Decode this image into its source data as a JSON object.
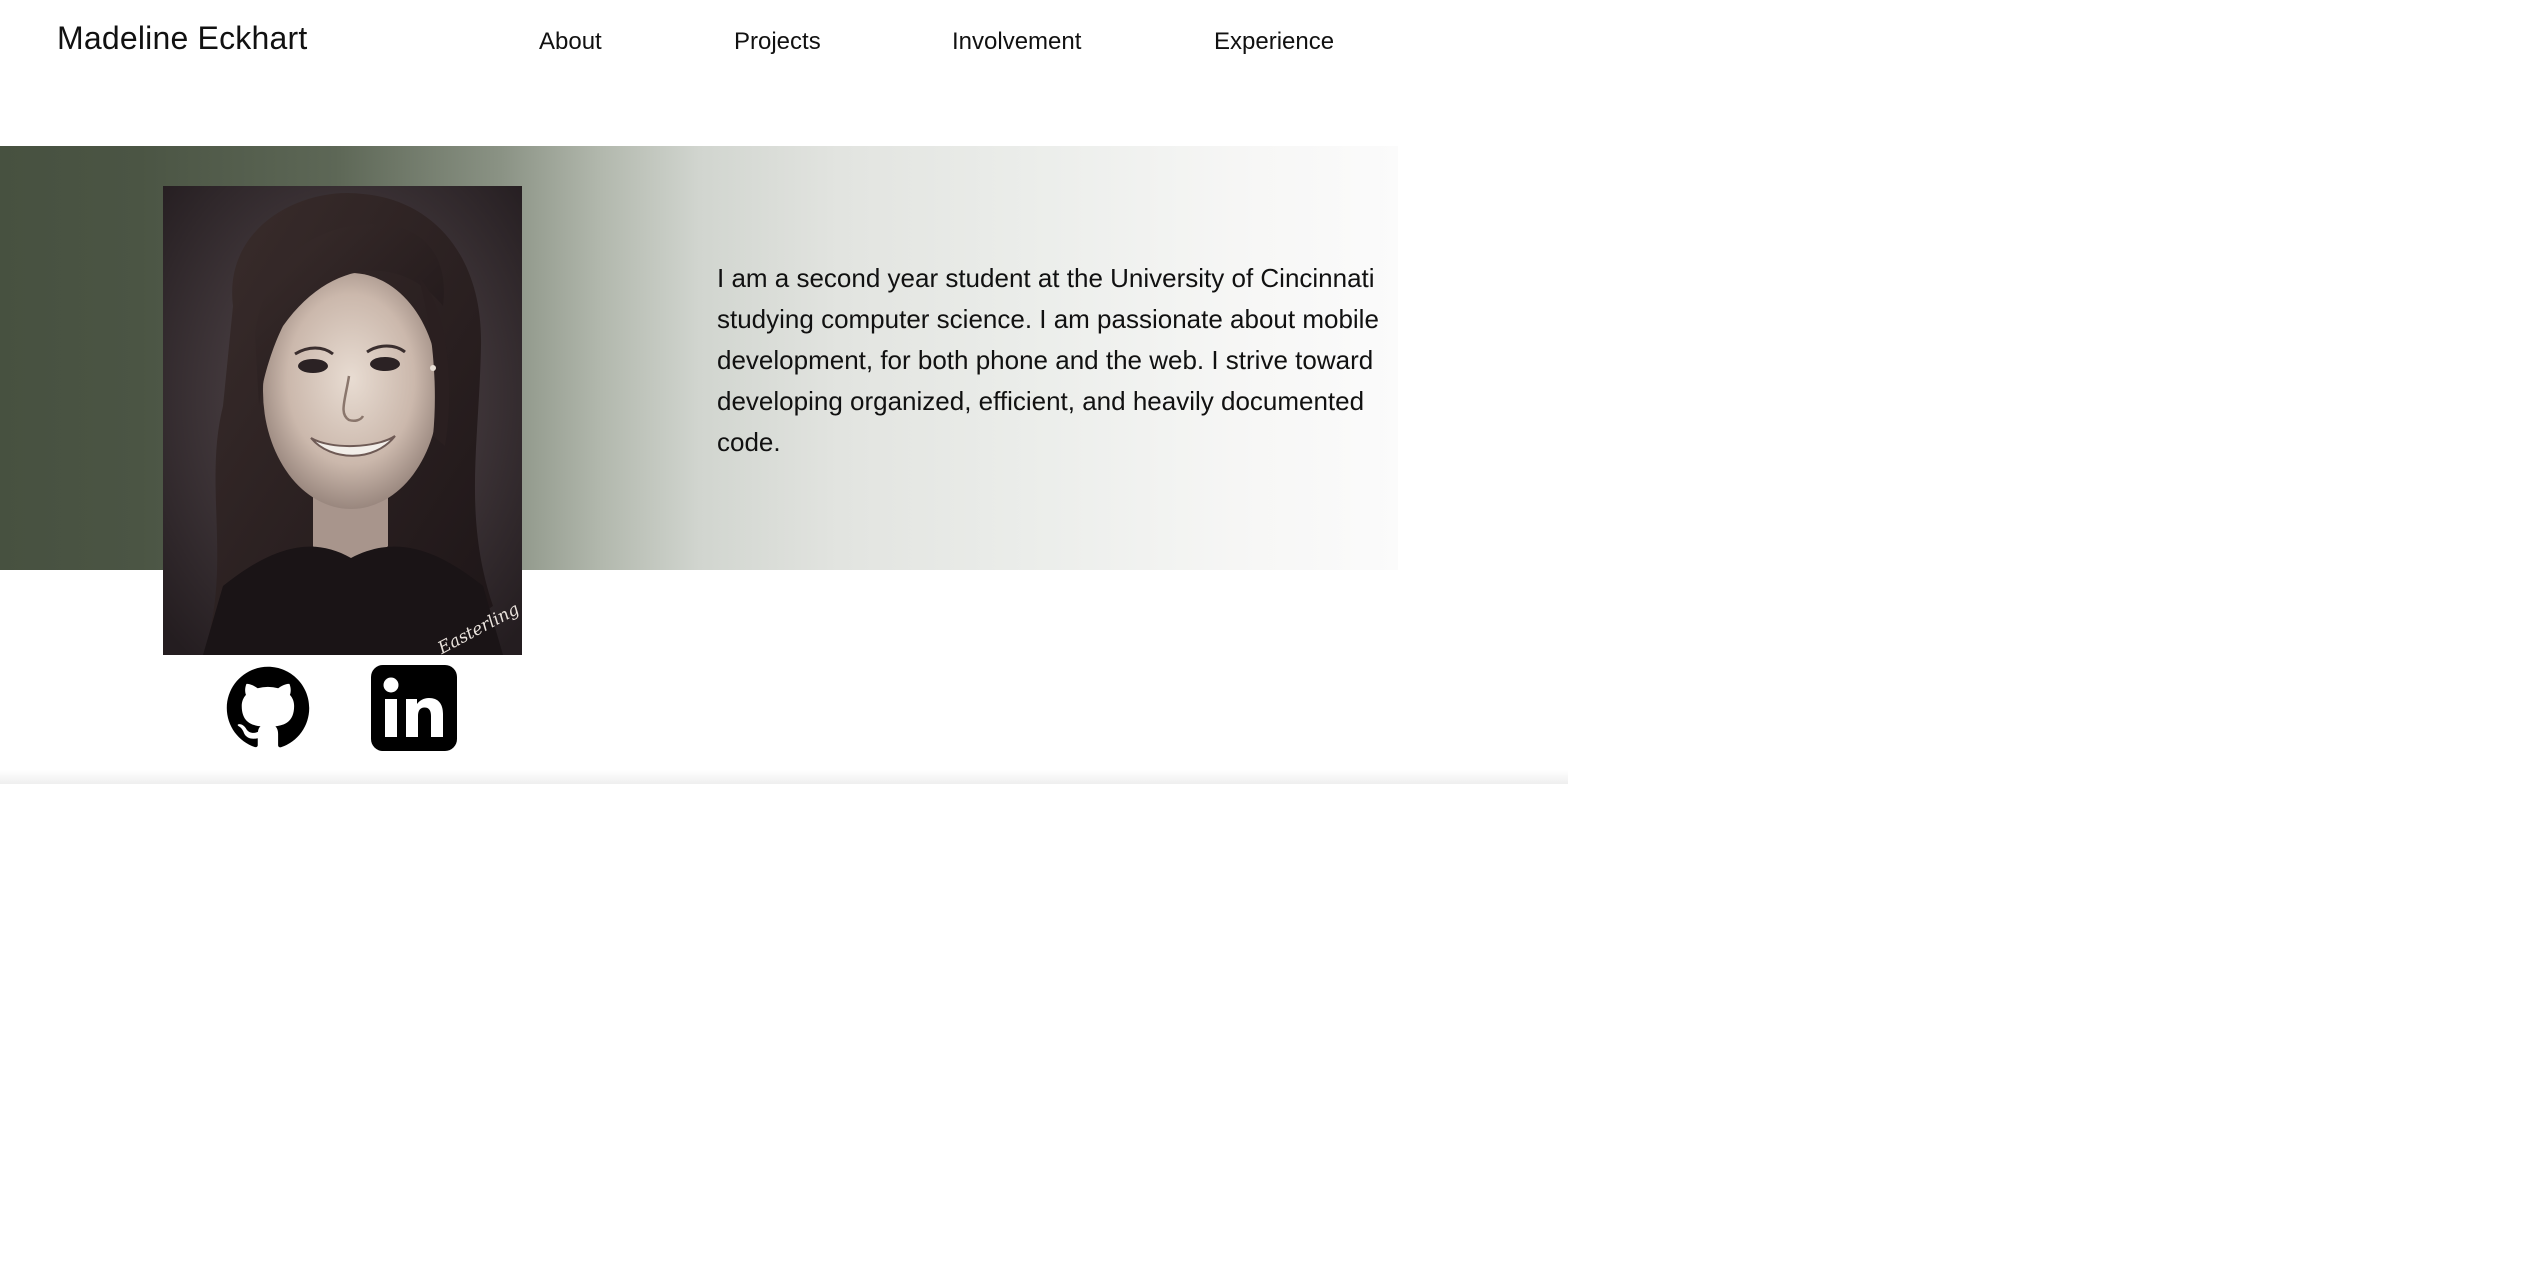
{
  "header": {
    "site_name": "Madeline Eckhart",
    "nav": [
      {
        "label": "About"
      },
      {
        "label": "Projects"
      },
      {
        "label": "Involvement"
      },
      {
        "label": "Experience"
      }
    ]
  },
  "hero": {
    "bio": "I am a second year student at the University of Cincinnati studying computer science. I am passionate about mobile development, for both phone and the web. I strive toward developing organized, efficient, and heavily documented code.",
    "portrait_watermark": "Easterling ©"
  },
  "social": [
    {
      "icon": "github-icon"
    },
    {
      "icon": "linkedin-icon"
    }
  ],
  "colors": {
    "hero_gradient_start": "#475140",
    "hero_gradient_end": "#fbfbfb",
    "text": "#111111",
    "icon": "#000000"
  }
}
